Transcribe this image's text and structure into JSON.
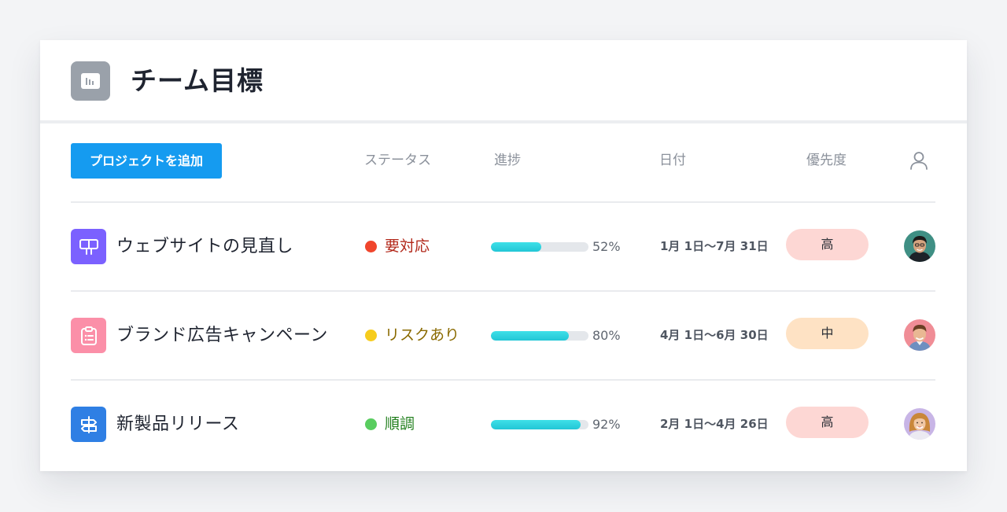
{
  "header": {
    "title": "チーム目標",
    "icon": "bar-chart-icon"
  },
  "toolbar": {
    "add_label": "プロジェクトを追加"
  },
  "columns": {
    "status": "ステータス",
    "progress": "進捗",
    "date": "日付",
    "priority": "優先度",
    "assignee_icon": "user-icon"
  },
  "rows": [
    {
      "name": "ウェブサイトの見直し",
      "icon": "board-icon",
      "icon_color": "#7b61ff",
      "status": "要対応",
      "status_color": "#f0452c",
      "status_text_color": "#b2281a",
      "progress": 0.52,
      "progress_label": "52%",
      "date": "1月 1日〜7月 31日",
      "priority": "高",
      "priority_color": "#fdd7d4"
    },
    {
      "name": "ブランド広告キャンペーン",
      "icon": "clipboard-icon",
      "icon_color": "#fb8fa8",
      "status": "リスクあり",
      "status_color": "#f6cc1d",
      "status_text_color": "#8a6a00",
      "progress": 0.8,
      "progress_label": "80%",
      "date": "4月 1日〜6月 30日",
      "priority": "中",
      "priority_color": "#fee2c4"
    },
    {
      "name": "新製品リリース",
      "icon": "signpost-icon",
      "icon_color": "#2f7fe4",
      "status": "順調",
      "status_color": "#59cd5f",
      "status_text_color": "#23801f",
      "progress": 0.92,
      "progress_label": "92%",
      "date": "2月 1日〜4月 26日",
      "priority": "高",
      "priority_color": "#fdd7d4"
    }
  ]
}
